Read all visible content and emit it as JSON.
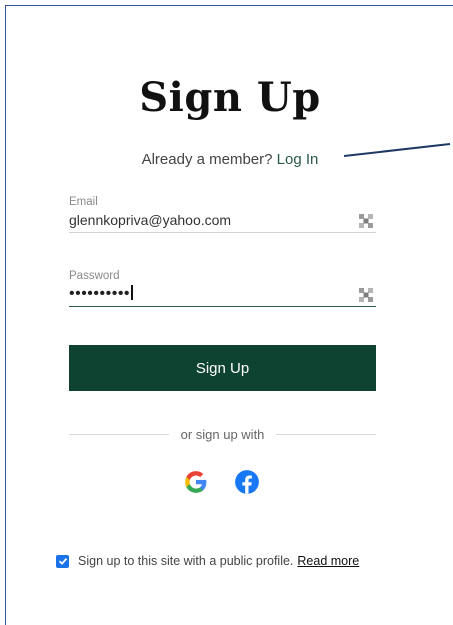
{
  "heading": "Sign Up",
  "login_prompt": {
    "text": "Already a member?",
    "link": "Log In"
  },
  "email": {
    "label": "Email",
    "value": "glennkopriva@yahoo.com"
  },
  "password": {
    "label": "Password",
    "masked_value": "••••••••••"
  },
  "submit_label": "Sign Up",
  "divider_text": "or sign up with",
  "social": [
    {
      "name": "Google",
      "icon": "google-icon"
    },
    {
      "name": "Facebook",
      "icon": "facebook-icon"
    }
  ],
  "consent": {
    "checked": true,
    "text": "Sign up to this site with a public profile.",
    "link": "Read more"
  },
  "colors": {
    "primary": "#0e4332",
    "link": "#2b5a46",
    "checkbox": "#1a73e8",
    "frame_border": "#2f5597",
    "annotation_line": "#1f3864"
  }
}
